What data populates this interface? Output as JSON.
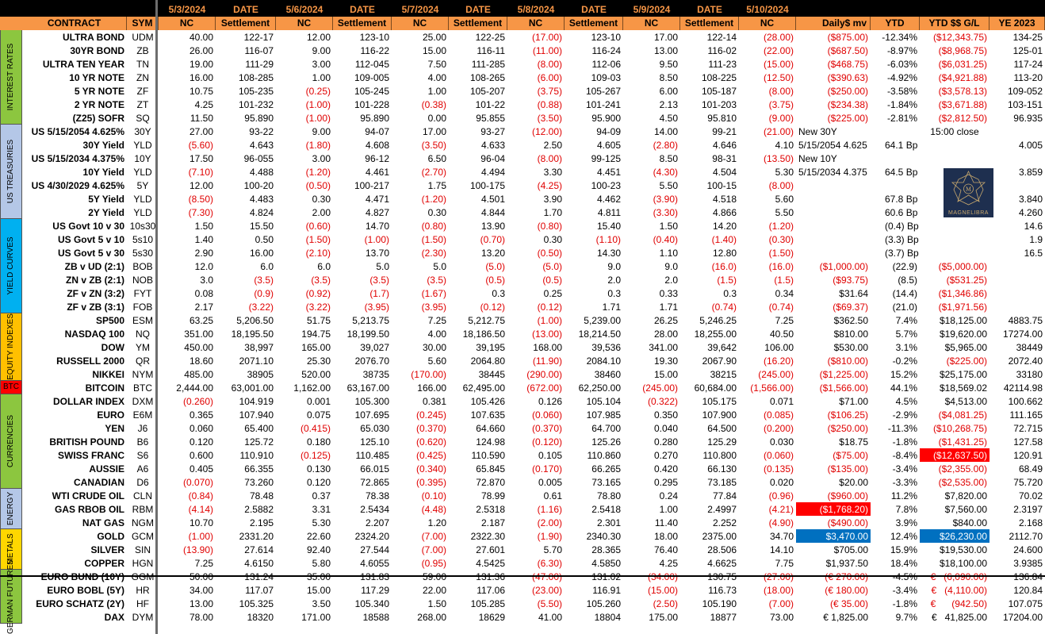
{
  "dates": {
    "d1": "5/3/2024",
    "w1": "DATE",
    "d2": "5/6/2024",
    "w2": "DATE",
    "d3": "5/7/2024",
    "w3": "DATE",
    "d4": "5/8/2024",
    "w4": "DATE",
    "d5": "5/9/2024",
    "w5": "DATE",
    "d6": "5/10/2024"
  },
  "headers": [
    "CONTRACT",
    "SYM",
    "NC",
    "Settlement",
    "NC",
    "Settlement",
    "NC",
    "Settlement",
    "NC",
    "Settlement",
    "NC",
    "Settlement",
    "NC",
    "Daily$ mv",
    "YTD",
    "YTD $$ G/L",
    "YE 2023"
  ],
  "groups": [
    {
      "label": "INTEREST RATES",
      "color": "#8cc63f"
    },
    {
      "label": "US TREASURIES",
      "color": "#b4c7e7"
    },
    {
      "label": "YIELD CURVES",
      "color": "#00b0f0"
    },
    {
      "label": "EQUITY INDEXES",
      "color": "#ffc000"
    },
    {
      "label": "BTC",
      "color": "#ff0000"
    },
    {
      "label": "CURRENCIES",
      "color": "#8cc63f"
    },
    {
      "label": "ENERGY",
      "color": "#b4c7e7"
    },
    {
      "label": "METALS",
      "color": "#ffd700"
    },
    {
      "label": "GERMAN FUTURES",
      "color": "#8cc63f"
    }
  ],
  "rows": [
    [
      "ULTRA BOND",
      "UDM",
      "40.00",
      "122-17",
      "12.00",
      "123-10",
      "25.00",
      "122-25",
      "(17.00)",
      "123-10",
      "17.00",
      "122-14",
      "(28.00)",
      "($875.00)",
      "-12.34%",
      "($12,343.75)",
      "134-25"
    ],
    [
      "30YR BOND",
      "ZB",
      "26.00",
      "116-07",
      "9.00",
      "116-22",
      "15.00",
      "116-11",
      "(11.00)",
      "116-24",
      "13.00",
      "116-02",
      "(22.00)",
      "($687.50)",
      "-8.97%",
      "($8,968.75)",
      "125-01"
    ],
    [
      "ULTRA TEN YEAR",
      "TN",
      "19.00",
      "111-29",
      "3.00",
      "112-045",
      "7.50",
      "111-285",
      "(8.00)",
      "112-06",
      "9.50",
      "111-23",
      "(15.00)",
      "($468.75)",
      "-6.03%",
      "($6,031.25)",
      "117-24"
    ],
    [
      "10 YR NOTE",
      "ZN",
      "16.00",
      "108-285",
      "1.00",
      "109-005",
      "4.00",
      "108-265",
      "(6.00)",
      "109-03",
      "8.50",
      "108-225",
      "(12.50)",
      "($390.63)",
      "-4.92%",
      "($4,921.88)",
      "113-20"
    ],
    [
      "5 YR NOTE",
      "ZF",
      "10.75",
      "105-235",
      "(0.25)",
      "105-245",
      "1.00",
      "105-207",
      "(3.75)",
      "105-267",
      "6.00",
      "105-187",
      "(8.00)",
      "($250.00)",
      "-3.58%",
      "($3,578.13)",
      "109-052"
    ],
    [
      "2 YR NOTE",
      "ZT",
      "4.25",
      "101-232",
      "(1.00)",
      "101-228",
      "(0.38)",
      "101-22",
      "(0.88)",
      "101-241",
      "2.13",
      "101-203",
      "(3.75)",
      "($234.38)",
      "-1.84%",
      "($3,671.88)",
      "103-151"
    ],
    [
      "(Z25) SOFR",
      "SQ",
      "11.50",
      "95.890",
      "(1.00)",
      "95.890",
      "0.00",
      "95.855",
      "(3.50)",
      "95.900",
      "4.50",
      "95.810",
      "(9.00)",
      "($225.00)",
      "-2.81%",
      "($2,812.50)",
      "96.935"
    ],
    [
      "US 5/15/2054 4.625%",
      "30Y",
      "27.00",
      "93-22",
      "9.00",
      "94-07",
      "17.00",
      "93-27",
      "(12.00)",
      "94-09",
      "14.00",
      "99-21",
      "(21.00)",
      "New 30Y",
      "",
      "15:00 close",
      ""
    ],
    [
      "30Y Yield",
      "YLD",
      "(5.60)",
      "4.643",
      "(1.80)",
      "4.608",
      "(3.50)",
      "4.633",
      "2.50",
      "4.605",
      "(2.80)",
      "4.646",
      "4.10",
      "5/15/2054 4.625",
      "64.1  Bp",
      "",
      "4.005"
    ],
    [
      "US 5/15/2034 4.375%",
      "10Y",
      "17.50",
      "96-055",
      "3.00",
      "96-12",
      "6.50",
      "96-04",
      "(8.00)",
      "99-125",
      "8.50",
      "98-31",
      "(13.50)",
      "New 10Y",
      "",
      "",
      ""
    ],
    [
      "10Y Yield",
      "YLD",
      "(7.10)",
      "4.488",
      "(1.20)",
      "4.461",
      "(2.70)",
      "4.494",
      "3.30",
      "4.451",
      "(4.30)",
      "4.504",
      "5.30",
      "5/15/2034 4.375",
      "64.5  Bp",
      "",
      "3.859"
    ],
    [
      "US 4/30/2029 4.625%",
      "5Y",
      "12.00",
      "100-20",
      "(0.50)",
      "100-217",
      "1.75",
      "100-175",
      "(4.25)",
      "100-23",
      "5.50",
      "100-15",
      "(8.00)",
      "",
      "",
      "",
      ""
    ],
    [
      "5Y Yield",
      "YLD",
      "(8.50)",
      "4.483",
      "0.30",
      "4.471",
      "(1.20)",
      "4.501",
      "3.90",
      "4.462",
      "(3.90)",
      "4.518",
      "5.60",
      "",
      "67.8  Bp",
      "",
      "3.840"
    ],
    [
      "2Y Yield",
      "YLD",
      "(7.30)",
      "4.824",
      "2.00",
      "4.827",
      "0.30",
      "4.844",
      "1.70",
      "4.811",
      "(3.30)",
      "4.866",
      "5.50",
      "",
      "60.6  Bp",
      "",
      "4.260"
    ],
    [
      "US Govt 10 v 30",
      "10s30",
      "1.50",
      "15.50",
      "(0.60)",
      "14.70",
      "(0.80)",
      "13.90",
      "(0.80)",
      "15.40",
      "1.50",
      "14.20",
      "(1.20)",
      "",
      "(0.4)  Bp",
      "",
      "14.6"
    ],
    [
      "US Govt 5 v 10",
      "5s10",
      "1.40",
      "0.50",
      "(1.50)",
      "(1.00)",
      "(1.50)",
      "(0.70)",
      "0.30",
      "(1.10)",
      "(0.40)",
      "(1.40)",
      "(0.30)",
      "",
      "(3.3)  Bp",
      "",
      "1.9"
    ],
    [
      "US Govt 5 v 30",
      "5s30",
      "2.90",
      "16.00",
      "(2.10)",
      "13.70",
      "(2.30)",
      "13.20",
      "(0.50)",
      "14.30",
      "1.10",
      "12.80",
      "(1.50)",
      "",
      "(3.7)  Bp",
      "",
      "16.5"
    ],
    [
      "ZB v UD (2:1)",
      "BOB",
      "12.0",
      "6.0",
      "6.0",
      "5.0",
      "5.0",
      "(5.0)",
      "(5.0)",
      "9.0",
      "9.0",
      "(16.0)",
      "(16.0)",
      "($1,000.00)",
      "(22.9)",
      "($5,000.00)",
      ""
    ],
    [
      "ZN v ZB (2:1)",
      "NOB",
      "3.0",
      "(3.5)",
      "(3.5)",
      "(3.5)",
      "(3.5)",
      "(0.5)",
      "(0.5)",
      "2.0",
      "2.0",
      "(1.5)",
      "(1.5)",
      "($93.75)",
      "(8.5)",
      "($531.25)",
      ""
    ],
    [
      "ZF v ZN (3:2)",
      "FYT",
      "0.08",
      "(0.9)",
      "(0.92)",
      "(1.7)",
      "(1.67)",
      "0.3",
      "0.25",
      "0.3",
      "0.33",
      "0.3",
      "0.34",
      "$31.64",
      "(14.4)",
      "($1,346.86)",
      ""
    ],
    [
      "ZF v ZB (3:1)",
      "FOB",
      "2.17",
      "(3.22)",
      "(3.22)",
      "(3.95)",
      "(3.95)",
      "(0.12)",
      "(0.12)",
      "1.71",
      "1.71",
      "(0.74)",
      "(0.74)",
      "($69.37)",
      "(21.0)",
      "($1,971.56)",
      ""
    ],
    [
      "SP500",
      "ESM",
      "63.25",
      "5,206.50",
      "51.75",
      "5,213.75",
      "7.25",
      "5,212.75",
      "(1.00)",
      "5,239.00",
      "26.25",
      "5,246.25",
      "7.25",
      "$362.50",
      "7.4%",
      "$18,125.00",
      "4883.75"
    ],
    [
      "NASDAQ 100",
      "NQ",
      "351.00",
      "18,195.50",
      "194.75",
      "18,199.50",
      "4.00",
      "18,186.50",
      "(13.00)",
      "18,214.50",
      "28.00",
      "18,255.00",
      "40.50",
      "$810.00",
      "5.7%",
      "$19,620.00",
      "17274.00"
    ],
    [
      "DOW",
      "YM",
      "450.00",
      "38,997",
      "165.00",
      "39,027",
      "30.00",
      "39,195",
      "168.00",
      "39,536",
      "341.00",
      "39,642",
      "106.00",
      "$530.00",
      "3.1%",
      "$5,965.00",
      "38449"
    ],
    [
      "RUSSELL 2000",
      "QR",
      "18.60",
      "2071.10",
      "25.30",
      "2076.70",
      "5.60",
      "2064.80",
      "(11.90)",
      "2084.10",
      "19.30",
      "2067.90",
      "(16.20)",
      "($810.00)",
      "-0.2%",
      "($225.00)",
      "2072.40"
    ],
    [
      "NIKKEI",
      "NYM",
      "485.00",
      "38905",
      "520.00",
      "38735",
      "(170.00)",
      "38445",
      "(290.00)",
      "38460",
      "15.00",
      "38215",
      "(245.00)",
      "($1,225.00)",
      "15.2%",
      "$25,175.00",
      "33180"
    ],
    [
      "BITCOIN",
      "BTC",
      "2,444.00",
      "63,001.00",
      "1,162.00",
      "63,167.00",
      "166.00",
      "62,495.00",
      "(672.00)",
      "62,250.00",
      "(245.00)",
      "60,684.00",
      "(1,566.00)",
      "($1,566.00)",
      "44.1%",
      "$18,569.02",
      "42114.98"
    ],
    [
      "DOLLAR INDEX",
      "DXM",
      "(0.260)",
      "104.919",
      "0.001",
      "105.300",
      "0.381",
      "105.426",
      "0.126",
      "105.104",
      "(0.322)",
      "105.175",
      "0.071",
      "$71.00",
      "4.5%",
      "$4,513.00",
      "100.662"
    ],
    [
      "EURO",
      "E6M",
      "0.365",
      "107.940",
      "0.075",
      "107.695",
      "(0.245)",
      "107.635",
      "(0.060)",
      "107.985",
      "0.350",
      "107.900",
      "(0.085)",
      "($106.25)",
      "-2.9%",
      "($4,081.25)",
      "111.165"
    ],
    [
      "YEN",
      "J6",
      "0.060",
      "65.400",
      "(0.415)",
      "65.030",
      "(0.370)",
      "64.660",
      "(0.370)",
      "64.700",
      "0.040",
      "64.500",
      "(0.200)",
      "($250.00)",
      "-11.3%",
      "($10,268.75)",
      "72.715"
    ],
    [
      "BRITISH POUND",
      "B6",
      "0.120",
      "125.72",
      "0.180",
      "125.10",
      "(0.620)",
      "124.98",
      "(0.120)",
      "125.26",
      "0.280",
      "125.29",
      "0.030",
      "$18.75",
      "-1.8%",
      "($1,431.25)",
      "127.58"
    ],
    [
      "SWISS FRANC",
      "S6",
      "0.600",
      "110.910",
      "(0.125)",
      "110.485",
      "(0.425)",
      "110.590",
      "0.105",
      "110.860",
      "0.270",
      "110.800",
      "(0.060)",
      "($75.00)",
      "-8.4%",
      "($12,637.50)",
      "120.91"
    ],
    [
      "AUSSIE",
      "A6",
      "0.405",
      "66.355",
      "0.130",
      "66.015",
      "(0.340)",
      "65.845",
      "(0.170)",
      "66.265",
      "0.420",
      "66.130",
      "(0.135)",
      "($135.00)",
      "-3.4%",
      "($2,355.00)",
      "68.49"
    ],
    [
      "CANADIAN",
      "D6",
      "(0.070)",
      "73.260",
      "0.120",
      "72.865",
      "(0.395)",
      "72.870",
      "0.005",
      "73.165",
      "0.295",
      "73.185",
      "0.020",
      "$20.00",
      "-3.3%",
      "($2,535.00)",
      "75.720"
    ],
    [
      "WTI CRUDE OIL",
      "CLN",
      "(0.84)",
      "78.48",
      "0.37",
      "78.38",
      "(0.10)",
      "78.99",
      "0.61",
      "78.80",
      "0.24",
      "77.84",
      "(0.96)",
      "($960.00)",
      "11.2%",
      "$7,820.00",
      "70.02"
    ],
    [
      "GAS RBOB OIL",
      "RBM",
      "(4.14)",
      "2.5882",
      "3.31",
      "2.5434",
      "(4.48)",
      "2.5318",
      "(1.16)",
      "2.5418",
      "1.00",
      "2.4997",
      "(4.21)",
      "($1,768.20)",
      "7.8%",
      "$7,560.00",
      "2.3197"
    ],
    [
      "NAT GAS",
      "NGM",
      "10.70",
      "2.195",
      "5.30",
      "2.207",
      "1.20",
      "2.187",
      "(2.00)",
      "2.301",
      "11.40",
      "2.252",
      "(4.90)",
      "($490.00)",
      "3.9%",
      "$840.00",
      "2.168"
    ],
    [
      "GOLD",
      "GCM",
      "(1.00)",
      "2331.20",
      "22.60",
      "2324.20",
      "(7.00)",
      "2322.30",
      "(1.90)",
      "2340.30",
      "18.00",
      "2375.00",
      "34.70",
      "$3,470.00",
      "12.4%",
      "$26,230.00",
      "2112.70"
    ],
    [
      "SILVER",
      "SIN",
      "(13.90)",
      "27.614",
      "92.40",
      "27.544",
      "(7.00)",
      "27.601",
      "5.70",
      "28.365",
      "76.40",
      "28.506",
      "14.10",
      "$705.00",
      "15.9%",
      "$19,530.00",
      "24.600"
    ],
    [
      "COPPER",
      "HGN",
      "7.25",
      "4.6150",
      "5.80",
      "4.6055",
      "(0.95)",
      "4.5425",
      "(6.30)",
      "4.5850",
      "4.25",
      "4.6625",
      "7.75",
      "$1,937.50",
      "18.4%",
      "$18,100.00",
      "3.9385"
    ],
    [
      "EURO BUND (10Y)",
      "GGM",
      "50.00",
      "131.24",
      "35.00",
      "131.83",
      "59.00",
      "131.36",
      "(47.00)",
      "131.02",
      "(34.00)",
      "130.75",
      "(27.00)",
      "(€ 270.00)",
      "-4.5%",
      "€   (6,090.00)",
      "136.84"
    ],
    [
      "EURO BOBL (5Y)",
      "HR",
      "34.00",
      "117.07",
      "15.00",
      "117.29",
      "22.00",
      "117.06",
      "(23.00)",
      "116.91",
      "(15.00)",
      "116.73",
      "(18.00)",
      "(€ 180.00)",
      "-3.4%",
      "€   (4,110.00)",
      "120.84"
    ],
    [
      "EURO SCHATZ (2Y)",
      "HF",
      "13.00",
      "105.325",
      "3.50",
      "105.340",
      "1.50",
      "105.285",
      "(5.50)",
      "105.260",
      "(2.50)",
      "105.190",
      "(7.00)",
      "(€ 35.00)",
      "-1.8%",
      "€      (942.50)",
      "107.075"
    ],
    [
      "DAX",
      "DYM",
      "78.00",
      "18320",
      "171.00",
      "18588",
      "268.00",
      "18629",
      "41.00",
      "18804",
      "175.00",
      "18877",
      "73.00",
      "€ 1,825.00",
      "9.7%",
      "€   41,825.00",
      "17204.00"
    ]
  ],
  "logo_text": "MAGNELIBRA"
}
